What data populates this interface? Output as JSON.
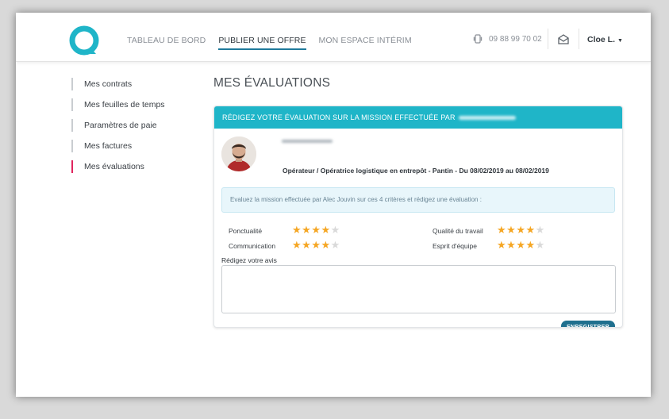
{
  "header": {
    "nav": [
      {
        "label": "TABLEAU DE BORD",
        "active": false
      },
      {
        "label": "PUBLIER UNE OFFRE",
        "active": true
      },
      {
        "label": "MON ESPACE INTÉRIM",
        "active": false
      }
    ],
    "phone": "09 88 99 70 02",
    "user": "Cloe L."
  },
  "sidebar": {
    "items": [
      {
        "label": "Mes contrats",
        "active": false
      },
      {
        "label": "Mes feuilles de temps",
        "active": false
      },
      {
        "label": "Paramètres de paie",
        "active": false
      },
      {
        "label": "Mes factures",
        "active": false
      },
      {
        "label": "Mes évaluations",
        "active": true
      }
    ]
  },
  "main": {
    "title": "MES ÉVALUATIONS",
    "card": {
      "header": "RÉDIGEZ VOTRE ÉVALUATION SUR LA MISSION EFFECTUÉE PAR",
      "mission": "Opérateur / Opératrice logistique en entrepôt - Pantin - Du 08/02/2019 au 08/02/2019",
      "info": "Evaluez la mission effectuée par Alec Jouvin sur ces 4 critères et rédigez une évaluation :",
      "criteria": [
        {
          "label": "Ponctualité",
          "rating": 4,
          "max": 5
        },
        {
          "label": "Communication",
          "rating": 4,
          "max": 5
        },
        {
          "label": "Qualité du travail",
          "rating": 4,
          "max": 5
        },
        {
          "label": "Esprit d'équipe",
          "rating": 4,
          "max": 5
        }
      ],
      "review_label": "Rédigez votre avis",
      "review_value": "",
      "save_label": "ENREGISTRER"
    }
  },
  "colors": {
    "accent": "#1fb5c8",
    "active_marker": "#e0245e",
    "button": "#1f6f8e",
    "star": "#f5a623",
    "star_empty": "#d9d9d9"
  }
}
